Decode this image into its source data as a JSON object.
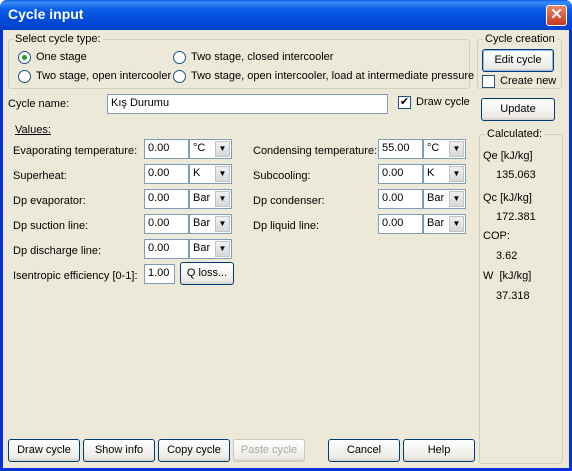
{
  "window": {
    "title": "Cycle input",
    "close": "✕"
  },
  "cycle_type": {
    "legend": "Select cycle type:",
    "options": [
      {
        "label": "One stage",
        "selected": true
      },
      {
        "label": "Two stage, closed intercooler",
        "selected": false
      },
      {
        "label": "Two stage, open intercooler",
        "selected": false
      },
      {
        "label": "Two stage, open intercooler, load at intermediate pressure",
        "selected": false
      }
    ]
  },
  "cycle_creation": {
    "legend": "Cycle creation",
    "edit_cycle": "Edit cycle",
    "create_new": "Create new",
    "create_new_checked": false
  },
  "cycle_name": {
    "label": "Cycle name:",
    "value": "Kış Durumu",
    "draw_cycle_label": "Draw cycle",
    "draw_cycle_checked": true,
    "check_mark": "✔"
  },
  "update_button": "Update",
  "values_heading": "Values:",
  "left_fields": [
    {
      "label": "Evaporating temperature:",
      "value": "0.00",
      "unit": "°C"
    },
    {
      "label": "Superheat:",
      "value": "0.00",
      "unit": "K"
    },
    {
      "label": "Dp evaporator:",
      "value": "0.00",
      "unit": "Bar"
    },
    {
      "label": "Dp suction line:",
      "value": "0.00",
      "unit": "Bar"
    },
    {
      "label": "Dp discharge line:",
      "value": "0.00",
      "unit": "Bar"
    }
  ],
  "right_fields": [
    {
      "label": "Condensing temperature:",
      "value": "55.00",
      "unit": "°C"
    },
    {
      "label": "Subcooling:",
      "value": "0.00",
      "unit": "K"
    },
    {
      "label": "Dp condenser:",
      "value": "0.00",
      "unit": "Bar"
    },
    {
      "label": "Dp liquid line:",
      "value": "0.00",
      "unit": "Bar"
    }
  ],
  "isentropic": {
    "label": "Isentropic efficiency [0-1]:",
    "value": "1.00",
    "q_loss": "Q loss..."
  },
  "calculated": {
    "legend": "Calculated:",
    "items": [
      {
        "label": "Qe [kJ/kg]",
        "value": "135.063"
      },
      {
        "label": "Qc [kJ/kg]",
        "value": "172.381"
      },
      {
        "label": "COP:",
        "value": "3.62"
      },
      {
        "label": "W  [kJ/kg]",
        "value": "37.318"
      }
    ]
  },
  "bottom_buttons": {
    "draw_cycle": "Draw cycle",
    "show_info": "Show info",
    "copy_cycle": "Copy cycle",
    "paste_cycle": "Paste cycle",
    "cancel": "Cancel",
    "help": "Help"
  },
  "arrow_glyph": "▼"
}
